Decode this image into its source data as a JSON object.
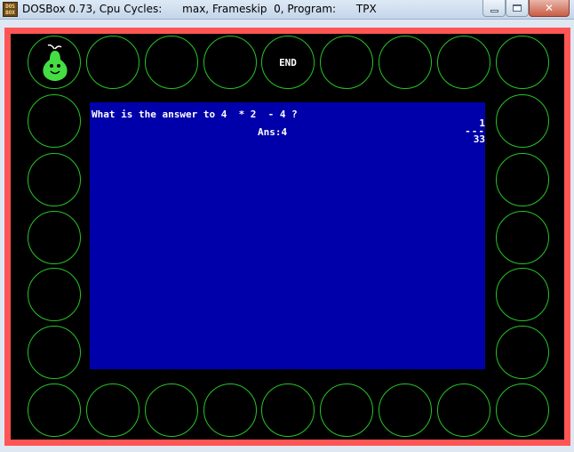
{
  "window": {
    "title": "DOSBox 0.73, Cpu Cycles:      max, Frameskip  0, Program:      TPX",
    "icon_text": [
      "DOS",
      "BOX"
    ],
    "close_glyph": "✕"
  },
  "board": {
    "end_label": "END",
    "token": "pear-character",
    "frame_color": "#ff5555",
    "circle_color": "#26c426"
  },
  "question": {
    "text": "What is the answer to 4  * 2  - 4 ?",
    "answer": "Ans:4",
    "progress_numerator": "1",
    "progress_bar": "---",
    "progress_denominator": "33"
  },
  "colors": {
    "panel": "#0000aa",
    "background": "#000000"
  }
}
